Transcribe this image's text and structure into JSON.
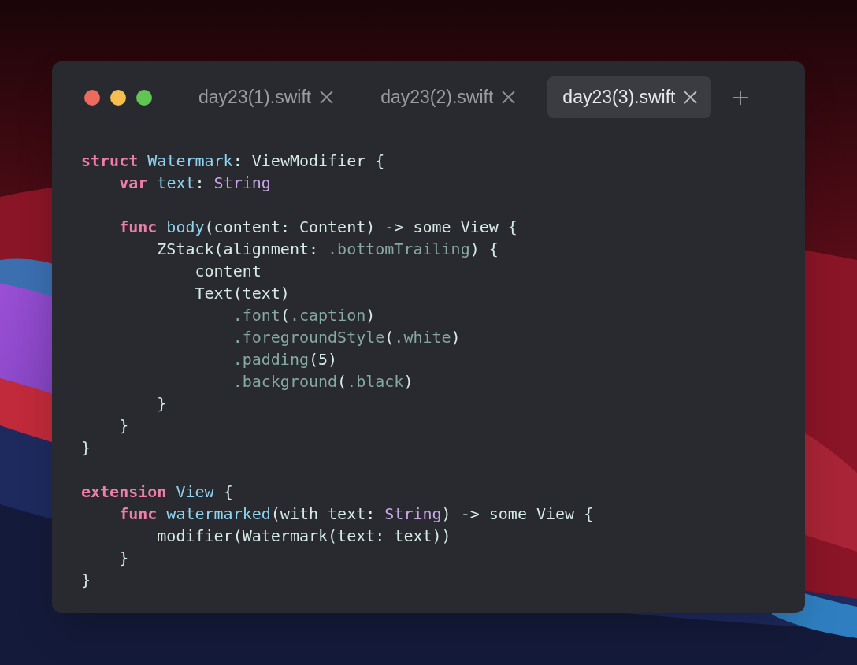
{
  "window": {
    "traffic_lights": [
      {
        "color": "#ec6a5e"
      },
      {
        "color": "#f4bf4f"
      },
      {
        "color": "#61c554"
      }
    ]
  },
  "tabs": [
    {
      "label": "day23(1).swift",
      "selected": false
    },
    {
      "label": "day23(2).swift",
      "selected": false
    },
    {
      "label": "day23(3).swift",
      "selected": true
    }
  ],
  "code": {
    "lines": [
      {
        "kind": "code",
        "tokens": [
          {
            "kind": "keyword",
            "text": "struct"
          },
          {
            "kind": "name",
            "text": " Watermark"
          },
          {
            "kind": "plain",
            "text": ": ViewModifier {"
          }
        ]
      },
      {
        "kind": "code",
        "tokens": [
          {
            "kind": "keyword",
            "text": "    var"
          },
          {
            "kind": "name",
            "text": " text"
          },
          {
            "kind": "plain",
            "text": ": "
          },
          {
            "kind": "type",
            "text": "String"
          }
        ]
      },
      {
        "kind": "blank"
      },
      {
        "kind": "code",
        "tokens": [
          {
            "kind": "keyword",
            "text": "    func"
          },
          {
            "kind": "name",
            "text": " body"
          },
          {
            "kind": "plain",
            "text": "(content: Content) -> some View {"
          }
        ]
      },
      {
        "kind": "code",
        "tokens": [
          {
            "kind": "plain",
            "text": "        ZStack(alignment: "
          },
          {
            "kind": "member",
            "text": ".bottomTrailing"
          },
          {
            "kind": "plain",
            "text": ") {"
          }
        ]
      },
      {
        "kind": "code",
        "tokens": [
          {
            "kind": "plain",
            "text": "            content"
          }
        ]
      },
      {
        "kind": "code",
        "tokens": [
          {
            "kind": "plain",
            "text": "            Text(text)"
          }
        ]
      },
      {
        "kind": "code",
        "tokens": [
          {
            "kind": "member",
            "text": "                .font"
          },
          {
            "kind": "plain",
            "text": "("
          },
          {
            "kind": "member",
            "text": ".caption"
          },
          {
            "kind": "plain",
            "text": ")"
          }
        ]
      },
      {
        "kind": "code",
        "tokens": [
          {
            "kind": "member",
            "text": "                .foregroundStyle"
          },
          {
            "kind": "plain",
            "text": "("
          },
          {
            "kind": "member",
            "text": ".white"
          },
          {
            "kind": "plain",
            "text": ")"
          }
        ]
      },
      {
        "kind": "code",
        "tokens": [
          {
            "kind": "member",
            "text": "                .padding"
          },
          {
            "kind": "plain",
            "text": "(5)"
          }
        ]
      },
      {
        "kind": "code",
        "tokens": [
          {
            "kind": "member",
            "text": "                .background"
          },
          {
            "kind": "plain",
            "text": "("
          },
          {
            "kind": "member",
            "text": ".black"
          },
          {
            "kind": "plain",
            "text": ")"
          }
        ]
      },
      {
        "kind": "code",
        "tokens": [
          {
            "kind": "plain",
            "text": "        }"
          }
        ]
      },
      {
        "kind": "code",
        "tokens": [
          {
            "kind": "plain",
            "text": "    }"
          }
        ]
      },
      {
        "kind": "code",
        "tokens": [
          {
            "kind": "plain",
            "text": "}"
          }
        ]
      },
      {
        "kind": "blank"
      },
      {
        "kind": "code",
        "tokens": [
          {
            "kind": "keyword",
            "text": "extension"
          },
          {
            "kind": "name",
            "text": " View"
          },
          {
            "kind": "plain",
            "text": " {"
          }
        ]
      },
      {
        "kind": "code",
        "tokens": [
          {
            "kind": "keyword",
            "text": "    func"
          },
          {
            "kind": "name",
            "text": " watermarked"
          },
          {
            "kind": "plain",
            "text": "(with text: "
          },
          {
            "kind": "type",
            "text": "String"
          },
          {
            "kind": "plain",
            "text": ") -> some View {"
          }
        ]
      },
      {
        "kind": "code",
        "tokens": [
          {
            "kind": "plain",
            "text": "        modifier(Watermark(text: text))"
          }
        ]
      },
      {
        "kind": "code",
        "tokens": [
          {
            "kind": "plain",
            "text": "    }"
          }
        ]
      },
      {
        "kind": "code",
        "tokens": [
          {
            "kind": "plain",
            "text": "}"
          }
        ]
      }
    ]
  }
}
